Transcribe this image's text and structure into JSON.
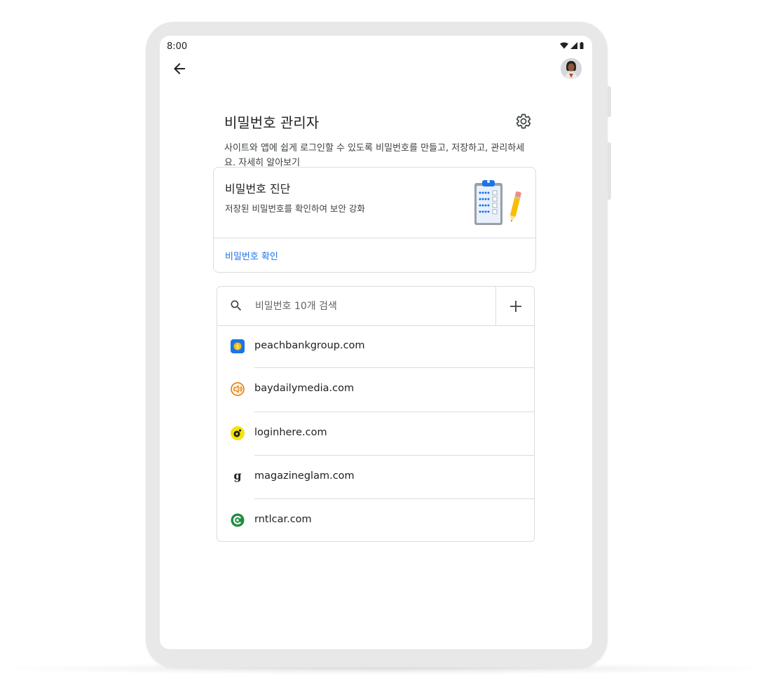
{
  "status_bar": {
    "time": "8:00"
  },
  "header": {
    "back_icon": "arrow-back-icon",
    "avatar_icon": "account-avatar"
  },
  "page": {
    "title": "비밀번호 관리자",
    "settings_icon": "gear-icon",
    "description": "사이트와 앱에 쉽게 로그인할 수 있도록 비밀번호를 만들고, 저장하고, 관리하세요.",
    "learn_more": "자세히 알아보기"
  },
  "checkup": {
    "title": "비밀번호 진단",
    "subtitle": "저장된 비밀번호를 확인하여 보안 강화",
    "action": "비밀번호 확인",
    "illustration": "clipboard-pencil-illustration"
  },
  "search": {
    "placeholder": "비밀번호 10개 검색",
    "icon": "search-icon",
    "add_icon": "plus-icon"
  },
  "sites": [
    {
      "name": "peachbankgroup.com",
      "icon": "peachbank-favicon",
      "color": "#1a73e8"
    },
    {
      "name": "baydailymedia.com",
      "icon": "baydailymedia-favicon",
      "color": "#e37400"
    },
    {
      "name": "loginhere.com",
      "icon": "loginhere-favicon",
      "color": "#f4e500"
    },
    {
      "name": "magazineglam.com",
      "icon": "magazineglam-favicon",
      "color": "#202124"
    },
    {
      "name": "rntlcar.com",
      "icon": "rntlcar-favicon",
      "color": "#1e8e3e"
    }
  ],
  "colors": {
    "accent": "#1a73e8",
    "divider": "#dadce0",
    "frame": "#e8e8e8"
  }
}
